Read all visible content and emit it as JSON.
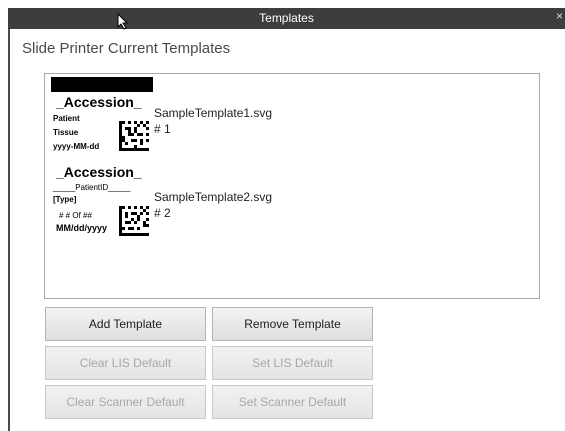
{
  "window": {
    "title": "Templates",
    "close_glyph": "×"
  },
  "heading": "Slide Printer Current Templates",
  "templates": [
    {
      "preview": {
        "accession": "_Accession_",
        "line1": "Patient",
        "line2": "Tissue",
        "line3": "yyyy-MM-dd"
      },
      "filename": "SampleTemplate1.svg",
      "number": "# 1"
    },
    {
      "preview": {
        "accession": "_Accession_",
        "line1": "_____PatientID_____",
        "line2": "[Type]",
        "line3": "#     # Of ##",
        "line4": "MM/dd/yyyy"
      },
      "filename": "SampleTemplate2.svg",
      "number": "# 2"
    }
  ],
  "buttons": {
    "add_template": "Add Template",
    "remove_template": "Remove Template",
    "clear_lis_default": "Clear LIS Default",
    "set_lis_default": "Set LIS Default",
    "clear_scanner_default": "Clear Scanner Default",
    "set_scanner_default": "Set Scanner Default"
  },
  "state": {
    "clear_lis_default_enabled": false,
    "set_lis_default_enabled": false,
    "clear_scanner_default_enabled": false,
    "set_scanner_default_enabled": false
  },
  "colors": {
    "titlebar": "#3d3d3d",
    "disabled_text": "#a8a8a8"
  },
  "icons": {
    "cursor": "mouse-pointer-icon",
    "qr": "datamatrix-barcode-icon"
  }
}
